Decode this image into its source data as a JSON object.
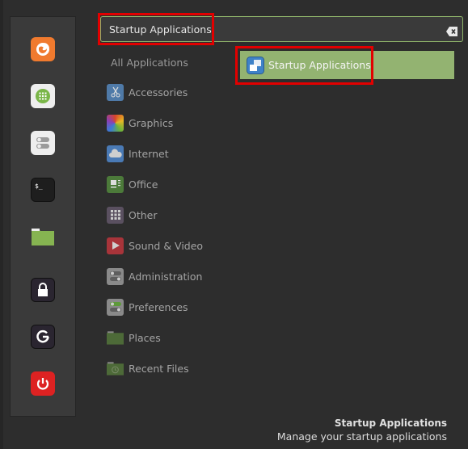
{
  "search": {
    "value": "Startup Applications",
    "clear_icon": "backspace-clear-icon"
  },
  "favorites": [
    {
      "name": "firefox",
      "icon": "firefox-icon",
      "color": "#f07a2e"
    },
    {
      "name": "software-manager",
      "icon": "software-manager-icon",
      "color": "#7ab648"
    },
    {
      "name": "settings",
      "icon": "settings-toggles-icon",
      "color": "#eeeeee"
    },
    {
      "name": "terminal",
      "icon": "terminal-icon",
      "color": "#1e1e1e"
    },
    {
      "name": "files",
      "icon": "folder-icon",
      "color": "#86b451"
    },
    {
      "name": "lock-screen",
      "icon": "lock-icon",
      "color": "#2a2530"
    },
    {
      "name": "logout",
      "icon": "logout-icon",
      "color": "#2a2530"
    },
    {
      "name": "shutdown",
      "icon": "power-icon",
      "color": "#dd2222"
    }
  ],
  "categories": {
    "all_label": "All Applications",
    "items": [
      {
        "label": "Accessories",
        "icon": "scissors-icon"
      },
      {
        "label": "Graphics",
        "icon": "graphics-icon"
      },
      {
        "label": "Internet",
        "icon": "cloud-icon"
      },
      {
        "label": "Office",
        "icon": "office-icon"
      },
      {
        "label": "Other",
        "icon": "grid-icon"
      },
      {
        "label": "Sound & Video",
        "icon": "play-icon"
      },
      {
        "label": "Administration",
        "icon": "admin-toggles-icon"
      },
      {
        "label": "Preferences",
        "icon": "preferences-toggles-icon"
      },
      {
        "label": "Places",
        "icon": "folder-icon"
      },
      {
        "label": "Recent Files",
        "icon": "recent-folder-icon"
      }
    ]
  },
  "results": [
    {
      "label": "Startup Applications",
      "icon": "startup-applications-icon"
    }
  ],
  "description": {
    "title": "Startup Applications",
    "text": "Manage your startup applications"
  },
  "colors": {
    "accent": "#93b371",
    "highlight": "#e20000",
    "background": "#2d2d2d"
  }
}
